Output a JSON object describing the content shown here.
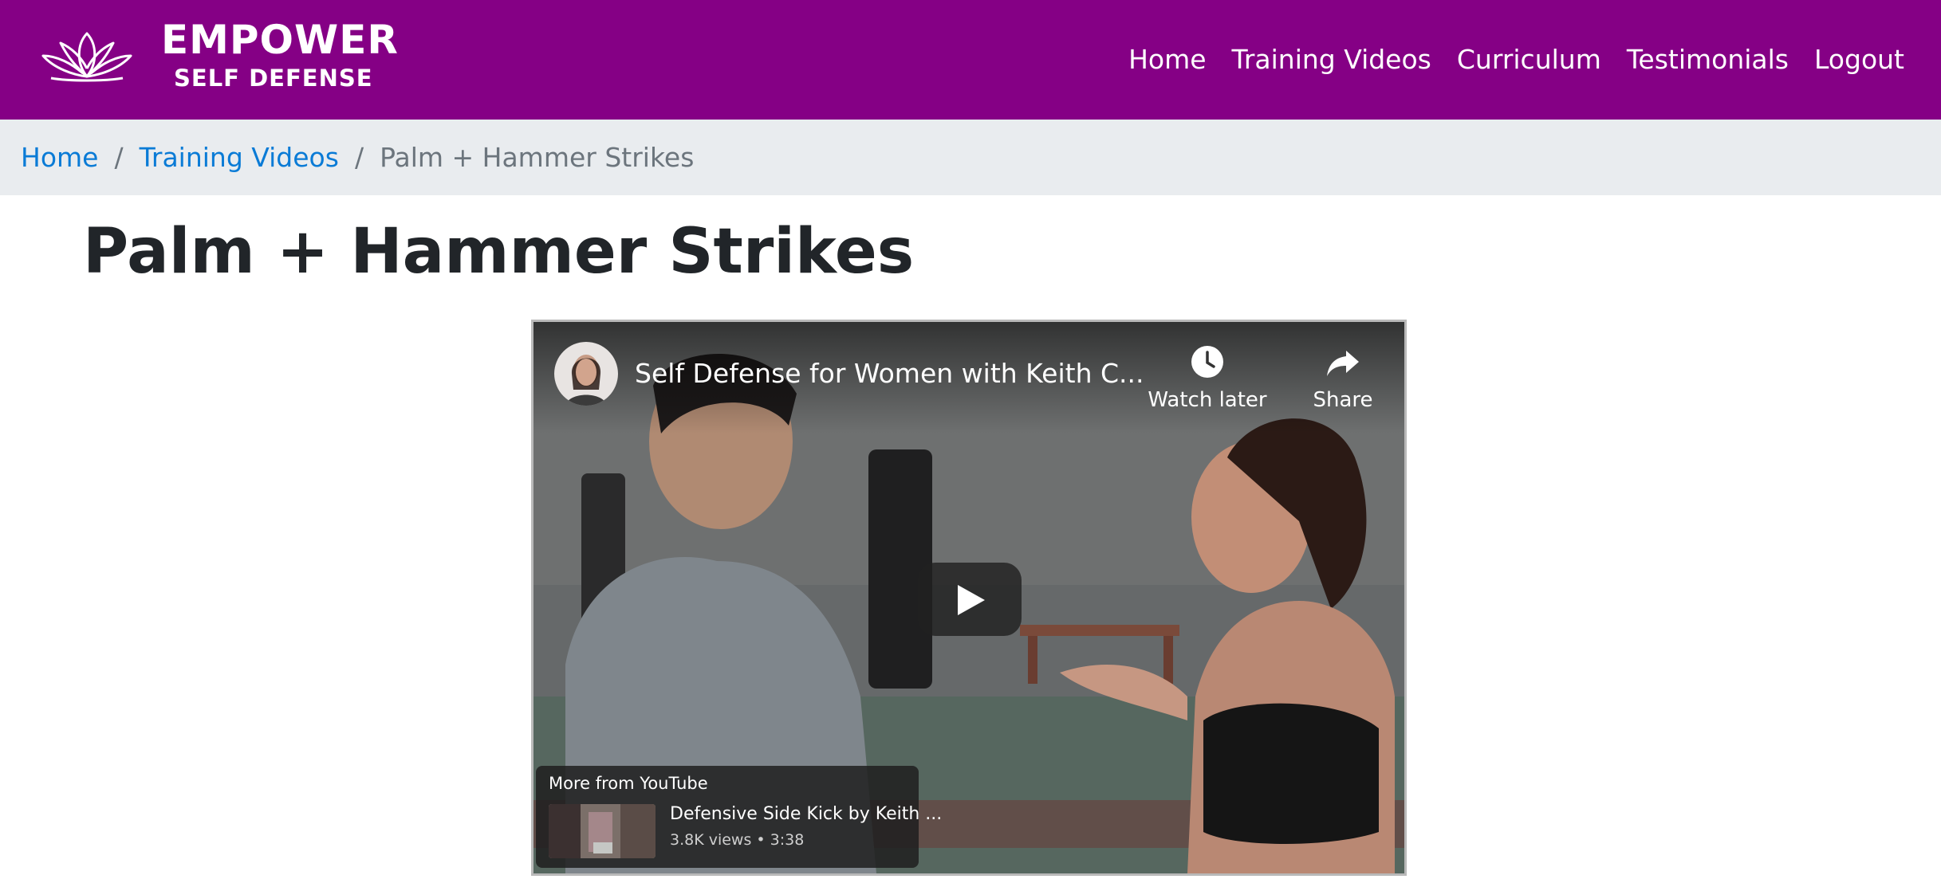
{
  "brand": {
    "name_line1": "EMPOWER",
    "name_line2": "SELF DEFENSE",
    "icon": "lotus-icon",
    "header_color": "#850085"
  },
  "nav": {
    "items": [
      {
        "label": "Home"
      },
      {
        "label": "Training Videos"
      },
      {
        "label": "Curriculum"
      },
      {
        "label": "Testimonials"
      },
      {
        "label": "Logout"
      }
    ]
  },
  "breadcrumb": {
    "home": "Home",
    "separator": "/",
    "section": "Training Videos",
    "current": "Palm + Hammer Strikes",
    "link_color": "#0a7bd6"
  },
  "page": {
    "title": "Palm + Hammer Strikes"
  },
  "video": {
    "title": "Self Defense for Women with Keith C...",
    "watch_later_label": "Watch later",
    "share_label": "Share",
    "watch_later_icon": "clock-icon",
    "share_icon": "share-arrow-icon",
    "play_icon": "play-icon",
    "more_from": "More from YouTube",
    "related": {
      "title": "Defensive Side Kick by Keith ...",
      "meta": "3.8K views • 3:38"
    }
  }
}
